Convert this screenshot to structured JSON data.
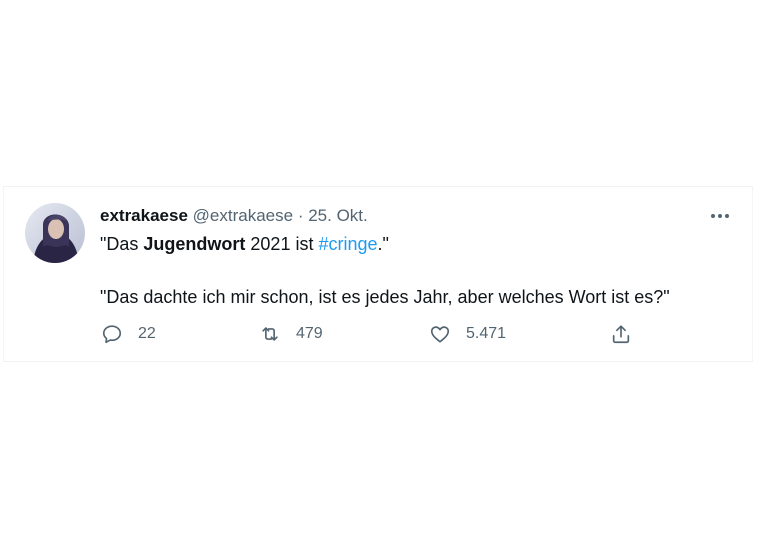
{
  "tweet": {
    "display_name": "extrakaese",
    "handle": "@extrakaese",
    "separator": "·",
    "date": "25. Okt.",
    "line1": {
      "prefix": "\"Das ",
      "bold": "Jugendwort",
      "middle": " 2021 ist ",
      "hashtag": "#cringe",
      "suffix": ".\""
    },
    "line2": "\"Das dachte ich mir schon, ist es jedes Jahr, aber welches Wort ist es?\"",
    "actions": {
      "replies": "22",
      "retweets": "479",
      "likes": "5.471"
    }
  },
  "icons": {
    "more": "more-horizontal-icon",
    "reply": "reply-bubble-icon",
    "retweet": "retweet-icon",
    "like": "heart-icon",
    "share": "share-icon"
  },
  "colors": {
    "link": "#1d9bf0",
    "secondary_text": "#536471",
    "primary_text": "#0f1419"
  }
}
